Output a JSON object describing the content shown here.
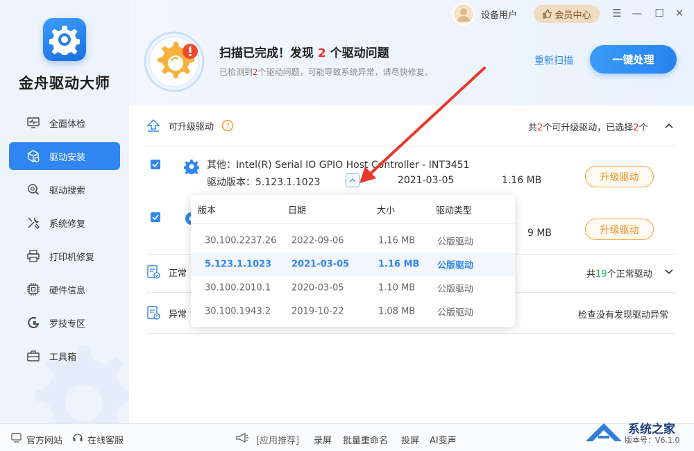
{
  "app": {
    "title": "金舟驱动大师"
  },
  "window": {
    "user_name": "设备用户",
    "vip_label": "会员中心",
    "menu": "☰",
    "minimize": "—",
    "maximize": "☐",
    "close": "✕"
  },
  "sidebar": {
    "items": [
      {
        "label": "全面体检",
        "icon": "monitor-heart-icon"
      },
      {
        "label": "驱动安装",
        "icon": "cube-gear-icon",
        "active": true
      },
      {
        "label": "驱动搜索",
        "icon": "search-gear-icon"
      },
      {
        "label": "系统修复",
        "icon": "tools-icon"
      },
      {
        "label": "打印机修复",
        "icon": "printer-icon"
      },
      {
        "label": "硬件信息",
        "icon": "chip-icon"
      },
      {
        "label": "罗技专区",
        "icon": "logitech-icon"
      },
      {
        "label": "工具箱",
        "icon": "toolbox-icon"
      }
    ]
  },
  "scan": {
    "title_prefix": "扫描已完成！发现",
    "count": "2",
    "title_suffix": "个驱动问题",
    "sub_prefix": "已检测到",
    "sub_count": "2",
    "sub_suffix": "个驱动问题，可能导致系统异常，请尽快修复。",
    "rescan_label": "重新扫描",
    "onekey_label": "一键处理"
  },
  "upgradable": {
    "title": "可升级驱动",
    "summary_prefix": "共",
    "summary_count": "2",
    "summary_mid": "个可升级驱动，已选择",
    "summary_selected": "2",
    "summary_suffix": "个"
  },
  "driver1": {
    "name": "其他：Intel(R) Serial IO GPIO Host Controller - INT3451",
    "version": "驱动版本：5.123.1.1023",
    "date": "2021-03-05",
    "size": "1.16 MB",
    "upgrade_label": "升级驱动"
  },
  "driver2": {
    "size": "9 MB",
    "upgrade_label": "升级驱动"
  },
  "dropdown": {
    "headers": [
      "版本",
      "日期",
      "大小",
      "驱动类型"
    ],
    "rows": [
      {
        "version": "30.100.2237.26",
        "date": "2022-09-06",
        "size": "1.16 MB",
        "type": "公版驱动",
        "selected": false
      },
      {
        "version": "5.123.1.1023",
        "date": "2021-03-05",
        "size": "1.16 MB",
        "type": "公版驱动",
        "selected": true
      },
      {
        "version": "30.100.2010.1",
        "date": "2020-03-05",
        "size": "1.10 MB",
        "type": "公版驱动",
        "selected": false
      },
      {
        "version": "30.100.1943.2",
        "date": "2019-10-22",
        "size": "1.08 MB",
        "type": "公版驱动",
        "selected": false
      }
    ]
  },
  "normal": {
    "title": "正常",
    "summary_prefix": "共",
    "summary_count": "19",
    "summary_suffix": "个正常驱动"
  },
  "abnormal": {
    "title": "异常",
    "summary": "检查没有发现驱动异常"
  },
  "footer": {
    "website": "官方网站",
    "support": "在线客服",
    "recommend": "[应用推荐]",
    "app1": "录屏",
    "app2": "批量重命名",
    "app3": "投屏",
    "app4": "AI变声"
  },
  "watermark": {
    "text": "系统之家",
    "version": "版本号：V6.1.0"
  },
  "colors": {
    "accent": "#2f86f0",
    "warning": "#f0302b",
    "upgrade": "#f08d16",
    "ok": "#27ae60"
  }
}
